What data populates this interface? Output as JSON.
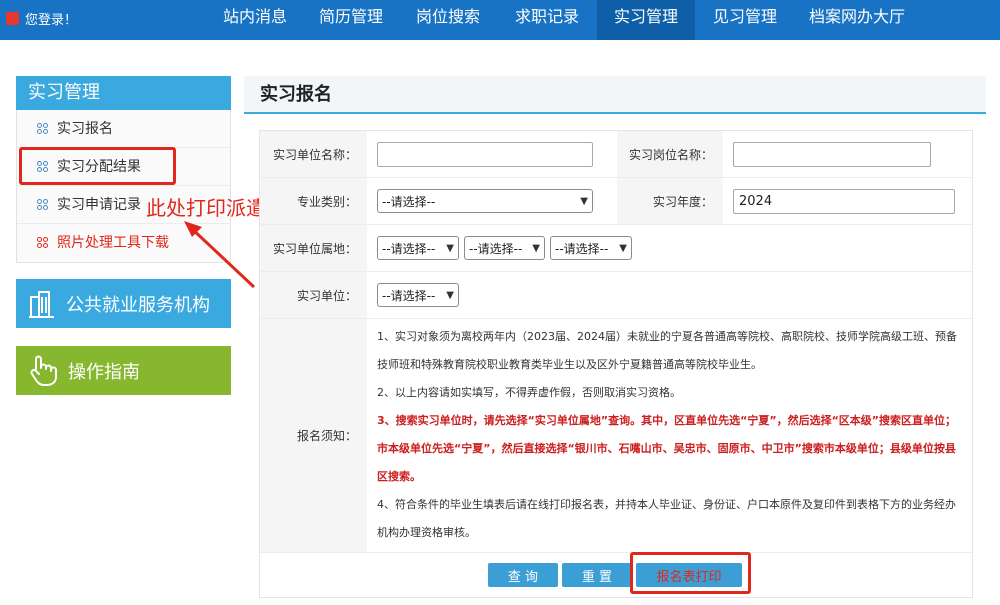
{
  "topbar": {
    "welcome": "您登录！",
    "nav": [
      "站内消息",
      "简历管理",
      "岗位搜索",
      "求职记录",
      "实习管理",
      "见习管理",
      "档案网办大厅"
    ],
    "active_index": 4
  },
  "sidebar": {
    "title": "实习管理",
    "items": [
      {
        "label": "实习报名"
      },
      {
        "label": "实习分配结果"
      },
      {
        "label": "实习申请记录"
      },
      {
        "label": "照片处理工具下载"
      }
    ],
    "service_button": "公共就业服务机构",
    "guide_button": "操作指南"
  },
  "annotation": "此处打印派遣单",
  "main": {
    "title": "实习报名"
  },
  "form": {
    "unit_name_label": "实习单位名称：",
    "unit_name_value": "",
    "post_name_label": "实习岗位名称：",
    "post_name_value": "",
    "major_label": "专业类别：",
    "major_select": "--请选择--",
    "year_label": "实习年度：",
    "year_value": "2024",
    "location_label": "实习单位属地：",
    "location_select_1": "--请选择--",
    "location_select_2": "--请选择--",
    "location_select_3": "--请选择--",
    "unit_label": "实习单位：",
    "unit_select": "--请选择--",
    "notes_label": "报名须知：",
    "notes": {
      "p1": "1、实习对象须为离校两年内（2023届、2024届）未就业的宁夏各普通高等院校、高职院校、技师学院高级工班、预备技师班和特殊教育院校职业教育类毕业生以及区外宁夏籍普通高等院校毕业生。",
      "p2": "2、以上内容请如实填写，不得弄虚作假，否则取消实习资格。",
      "p3": "3、搜索实习单位时，请先选择“实习单位属地”查询。其中，区直单位先选“宁夏”，然后选择“区本级”搜索区直单位；市本级单位先选“宁夏”，然后直接选择“银川市、石嘴山市、吴忠市、固原市、中卫市”搜索市本级单位；县级单位按县区搜索。",
      "p4": "4、符合条件的毕业生填表后请在线打印报名表，并持本人毕业证、身份证、户口本原件及复印件到表格下方的业务经办机构办理资格审核。"
    }
  },
  "buttons": {
    "query": "查 询",
    "reset": "重 置",
    "print": "报名表打印"
  },
  "colors": {
    "topbar": "#1873c4",
    "accent": "#3aa9e0",
    "guide": "#86b72f",
    "highlight": "#e0271b"
  }
}
